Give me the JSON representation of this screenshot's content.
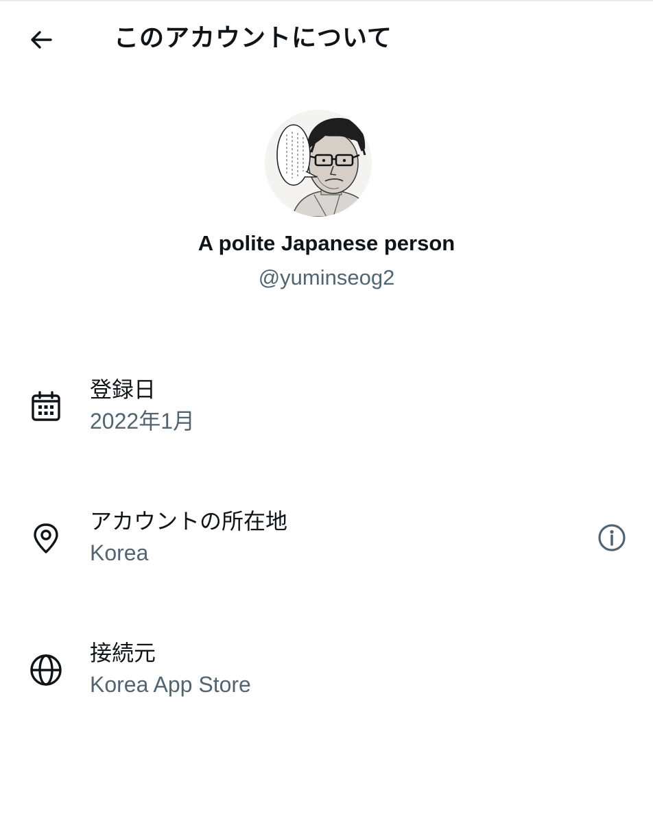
{
  "header": {
    "title": "このアカウントについて",
    "back_icon": "arrow-left-icon"
  },
  "profile": {
    "display_name": "A polite Japanese person",
    "handle": "@yuminseog2",
    "avatar_icon": "profile-avatar"
  },
  "rows": [
    {
      "label": "登録日",
      "value": "2022年1月",
      "icon": "calendar-icon"
    },
    {
      "label": "アカウントの所在地",
      "value": "Korea",
      "icon": "location-pin-icon",
      "trailing_icon": "info-icon"
    },
    {
      "label": "接続元",
      "value": "Korea App Store",
      "icon": "globe-icon"
    }
  ],
  "colors": {
    "primary_text": "#0f1419",
    "secondary_text": "#536471",
    "background": "#ffffff"
  }
}
